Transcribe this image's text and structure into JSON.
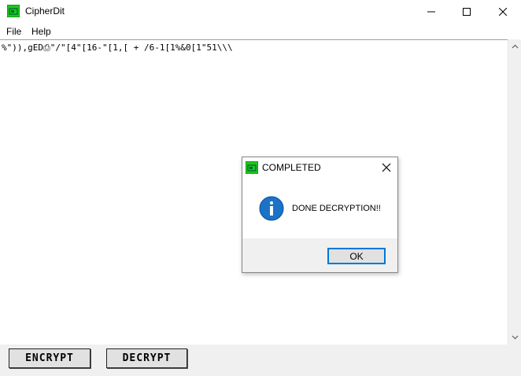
{
  "window": {
    "title": "CipherDit",
    "icon": "cipherdit-app-icon"
  },
  "menubar": {
    "file": "File",
    "help": "Help"
  },
  "editor": {
    "content": "%\")),gED⎙\"/\"[4\"[16-\"[1,[ + /6-1[1%&0[1\"51\\\\\\"
  },
  "buttons": {
    "encrypt": "ENCRYPT",
    "decrypt": "DECRYPT"
  },
  "dialog": {
    "title": "COMPLETED",
    "message": "DONE DECRYPTION!!",
    "ok_label": "OK",
    "icon": "info-icon"
  },
  "colors": {
    "accent": "#0078d7",
    "icon_green": "#1ec61e",
    "info_blue": "#1a73c9"
  }
}
